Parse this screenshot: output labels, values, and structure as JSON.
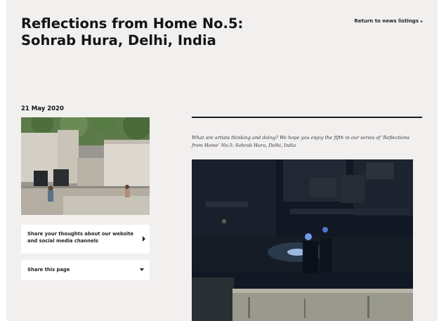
{
  "article": {
    "title_line1": "Reflections from Home No.5:",
    "title_line2": "Sohrab Hura, Delhi, India",
    "date": "21 May 2020",
    "intro": "What are artists thinking and doing? We hope you enjoy the fifth in our series of 'Reflections from Home' No.5: Sohrab Hura, Delhi, India"
  },
  "nav": {
    "return_label": "Return to news listings",
    "return_icon": "chevron-right-icon"
  },
  "sidebar": {
    "feedback_label": "Share your thoughts about our website and social media channels",
    "feedback_icon": "caret-right-icon",
    "share_label": "Share this page",
    "share_icon": "caret-down-icon"
  },
  "colors": {
    "page_background": "#f2efef",
    "text": "#141414",
    "card_background": "#ffffff",
    "rule": "#1a1a1a"
  }
}
